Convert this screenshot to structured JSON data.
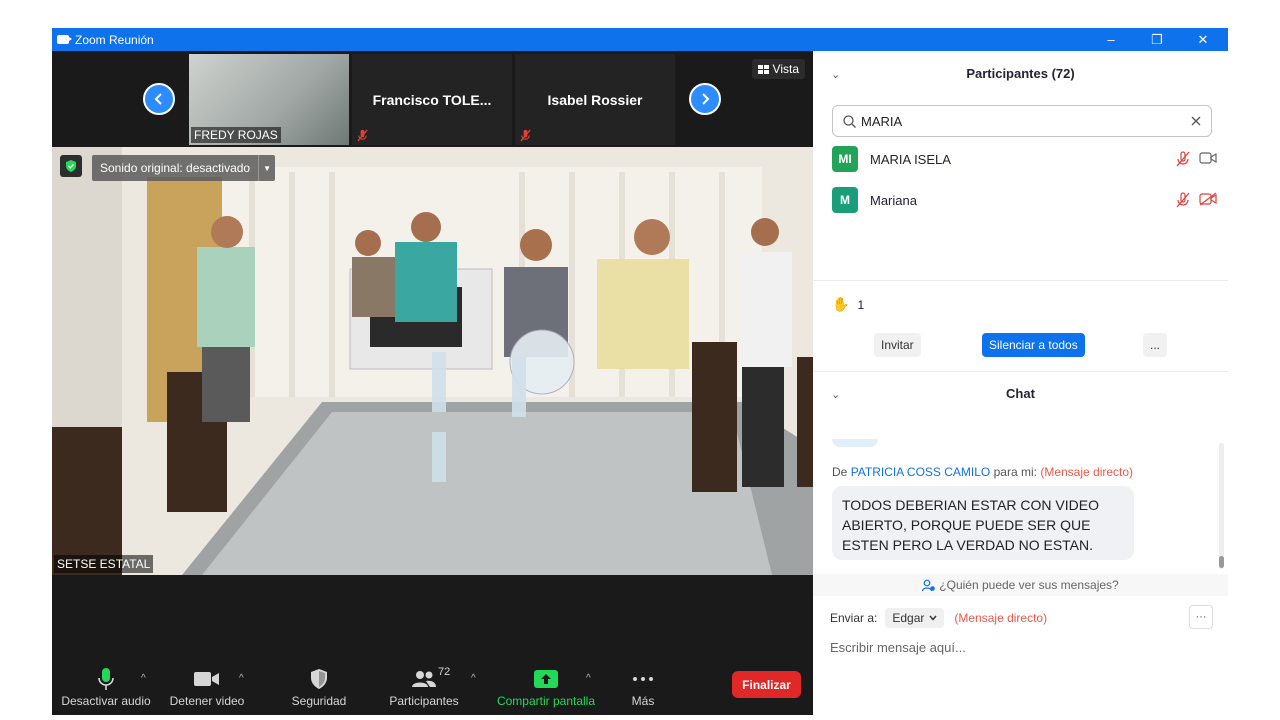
{
  "window": {
    "title": "Zoom Reunión",
    "minimize": "–",
    "maximize": "❐",
    "close": "✕"
  },
  "filmstrip": {
    "tiles": [
      {
        "name": "FREDY ROJAS"
      },
      {
        "name": "Francisco  TOLE..."
      },
      {
        "name": "Isabel Rossier"
      }
    ],
    "view_label": "Vista"
  },
  "main_video": {
    "sound_toggle": "Sonido original: desactivado",
    "speaker_name": "SETSE ESTATAL"
  },
  "toolbar": {
    "mute": "Desactivar audio",
    "video": "Detener video",
    "security": "Seguridad",
    "participants": "Participantes",
    "participants_count": "72",
    "share": "Compartir pantalla",
    "more": "Más",
    "end": "Finalizar"
  },
  "participants_panel": {
    "title": "Participantes (72)",
    "search_value": "MARIA",
    "list": [
      {
        "initials": "MI",
        "name": "MARIA ISELA",
        "color": "#23a35a"
      },
      {
        "initials": "M",
        "name": "Mariana",
        "color": "#1a9e7a"
      }
    ],
    "hands_raised": "1",
    "invite": "Invitar",
    "mute_all": "Silenciar a todos",
    "more": "..."
  },
  "chat": {
    "title": "Chat",
    "from_prefix": "De",
    "sender": "PATRICIA COSS CAMILO",
    "to_me": "para mi:",
    "dm_tag": "(Mensaje directo)",
    "message": "TODOS DEBERIAN ESTAR CON VIDEO ABIERTO, PORQUE PUEDE SER QUE ESTEN PERO LA VERDAD NO ESTAN.",
    "who_can_see": "¿Quién puede ver sus mensajes?",
    "send_to_label": "Enviar a:",
    "recipient": "Edgar",
    "send_dm_tag": "(Mensaje directo)",
    "more": "···",
    "input_placeholder": "Escribir mensaje aquí..."
  },
  "colors": {
    "zoom_blue": "#0e72ed",
    "end_red": "#e02828",
    "share_green": "#23d959",
    "dm_red": "#e8594a",
    "link_blue": "#0e72ed"
  }
}
